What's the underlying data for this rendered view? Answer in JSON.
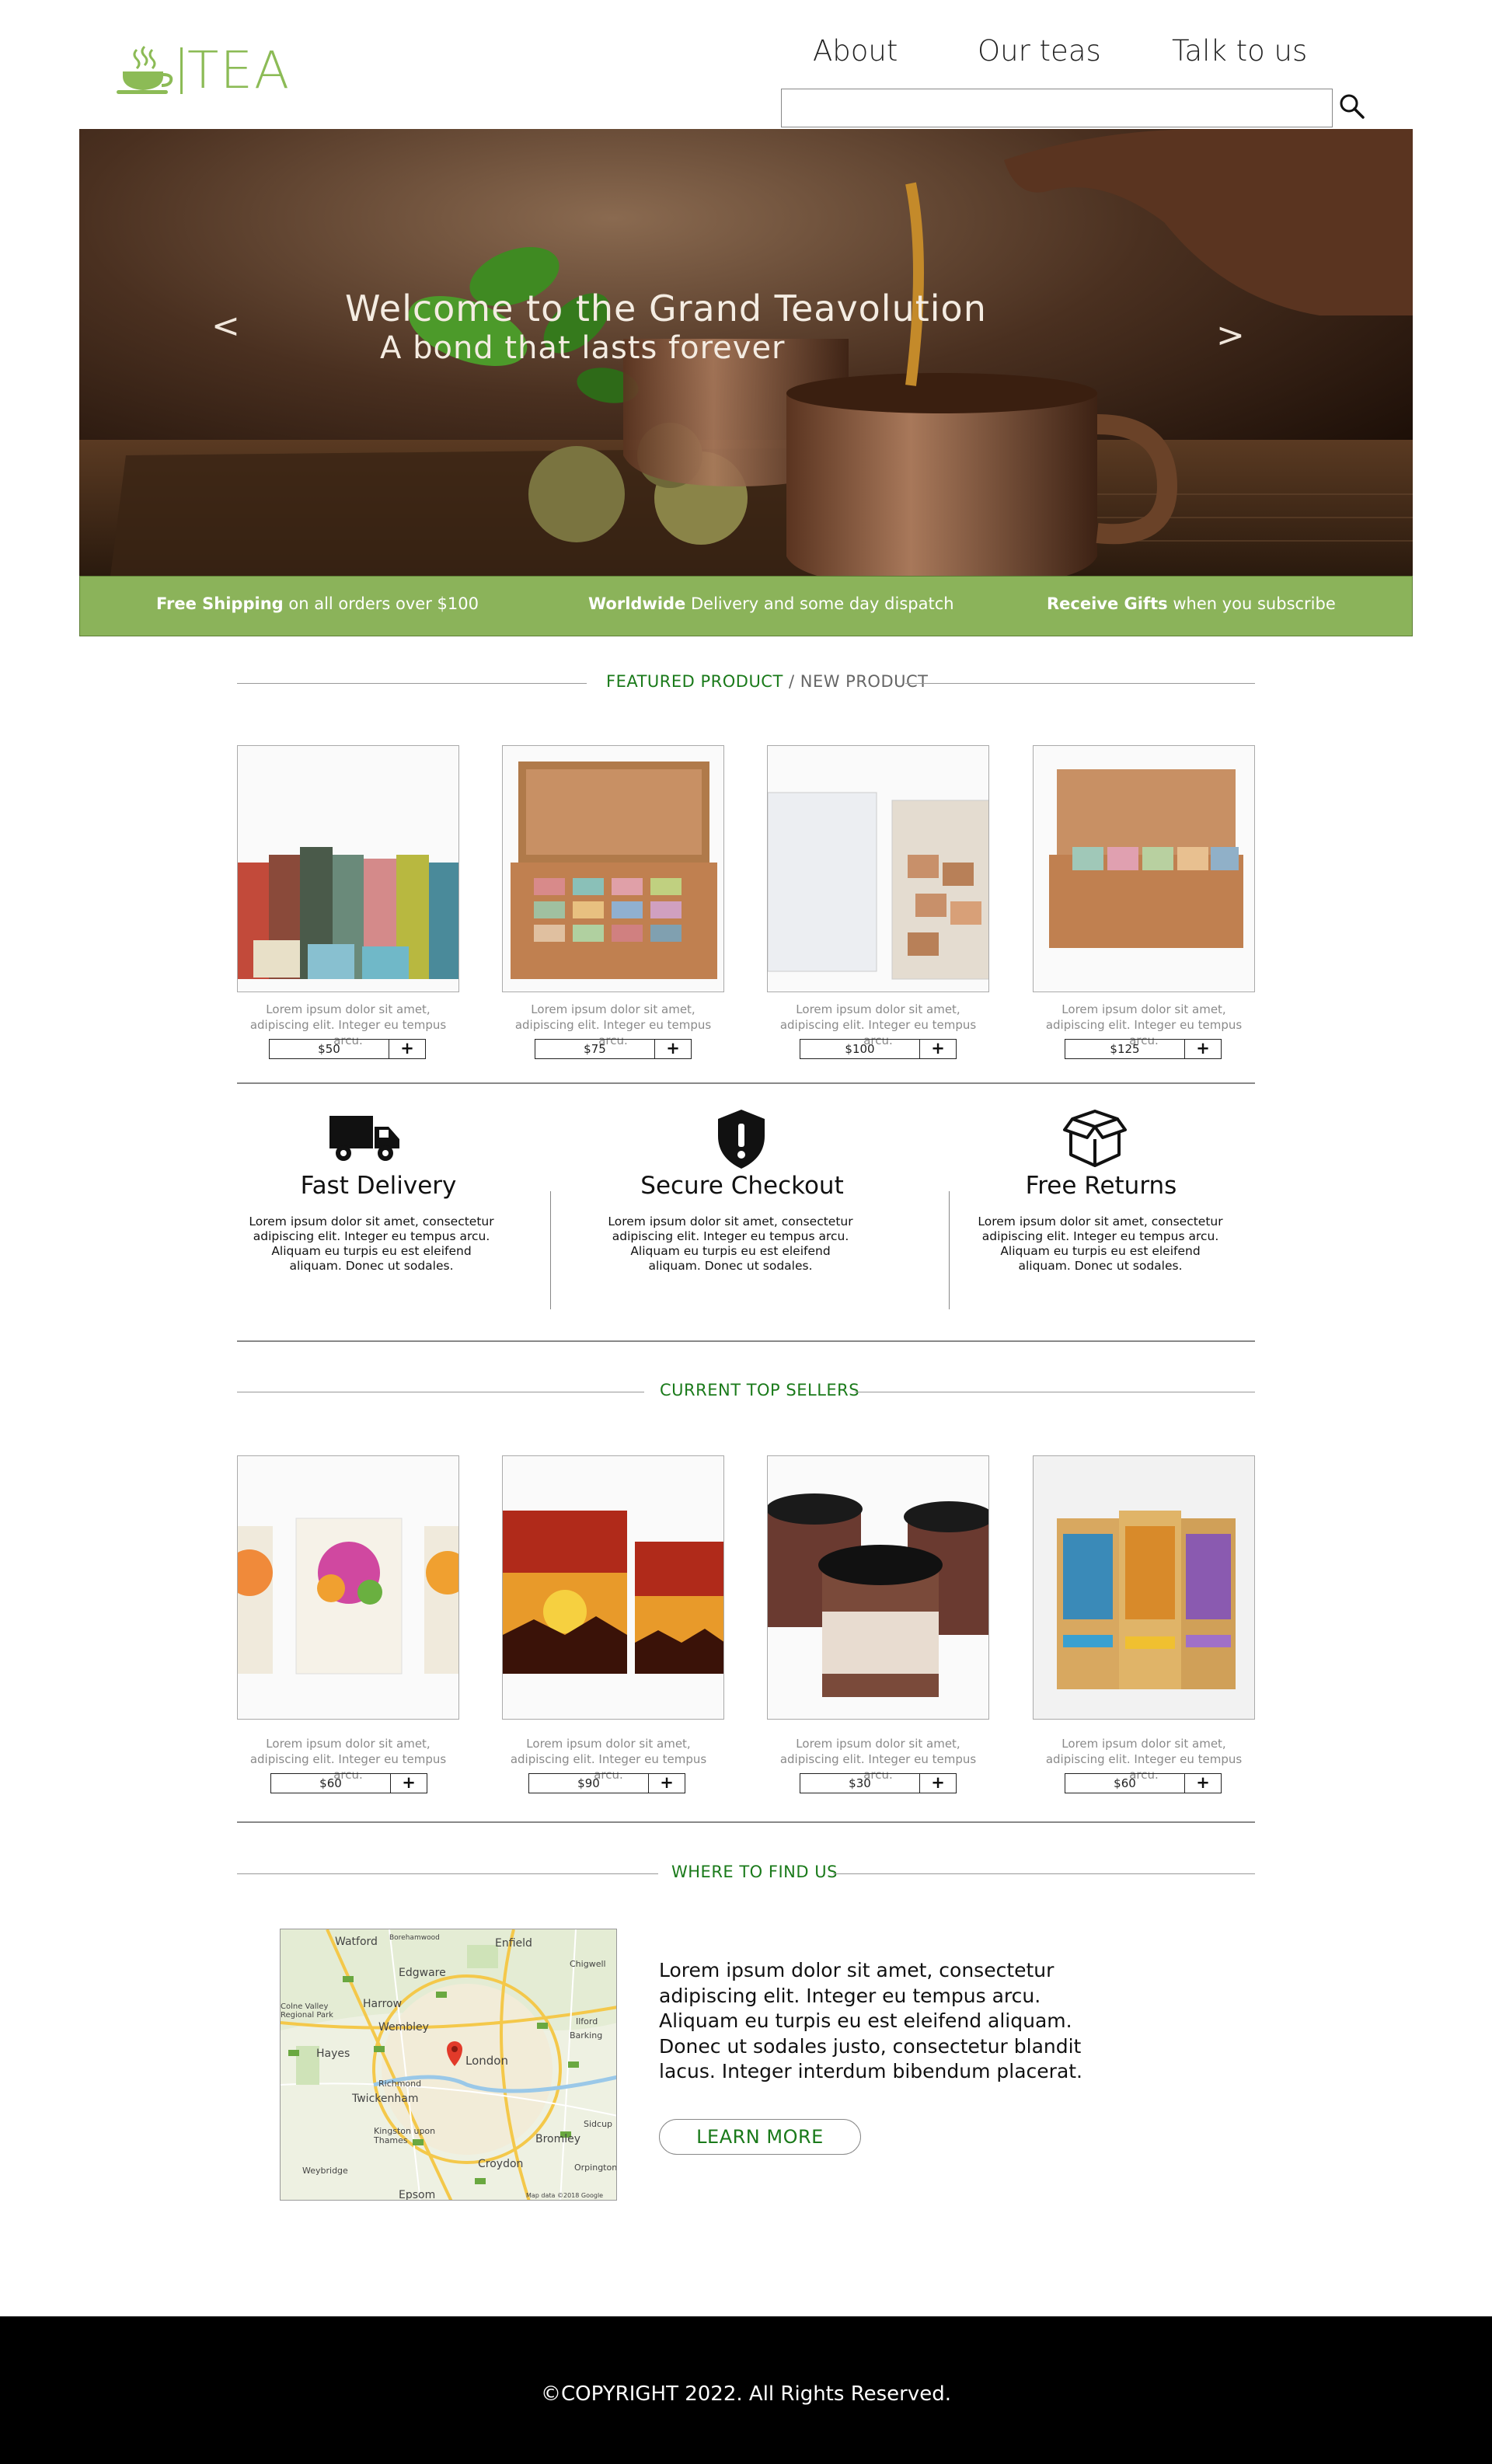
{
  "header": {
    "brand": "TEA",
    "nav": [
      "About",
      "Our teas",
      "Talk to us"
    ],
    "search_placeholder": ""
  },
  "hero": {
    "title": "Welcome to the Grand Teavolution",
    "subtitle": "A bond that lasts forever",
    "prev_icon": "<",
    "next_icon": ">"
  },
  "shipping": [
    {
      "bold": "Free Shipping",
      "text": " on all orders over $100"
    },
    {
      "bold": "Worldwide",
      "text": " Delivery and some day dispatch"
    },
    {
      "bold": "Receive Gifts",
      "text": " when you subscribe"
    }
  ],
  "featured": {
    "title_highlight": "FEATURED PRODUCT",
    "title_rest": " / NEW PRODUCT",
    "products": [
      {
        "desc": "Lorem ipsum dolor sit amet, adipiscing elit. Integer eu tempus arcu.",
        "price": "$50",
        "add": "+"
      },
      {
        "desc": "Lorem ipsum dolor sit amet, adipiscing elit. Integer eu tempus arcu.",
        "price": "$75",
        "add": "+"
      },
      {
        "desc": "Lorem ipsum dolor sit amet, adipiscing elit. Integer eu tempus arcu.",
        "price": "$100",
        "add": "+"
      },
      {
        "desc": "Lorem ipsum dolor sit amet, adipiscing elit. Integer eu tempus arcu.",
        "price": "$125",
        "add": "+"
      }
    ]
  },
  "features": [
    {
      "icon": "truck-icon",
      "title": "Fast Delivery",
      "text": "Lorem ipsum dolor sit amet, consectetur adipiscing elit. Integer eu tempus arcu. Aliquam eu turpis eu est eleifend aliquam. Donec ut sodales."
    },
    {
      "icon": "shield-icon",
      "title": "Secure Checkout",
      "text": "Lorem ipsum dolor sit amet, consectetur adipiscing elit. Integer eu tempus arcu. Aliquam eu turpis eu est eleifend aliquam. Donec ut sodales."
    },
    {
      "icon": "box-icon",
      "title": "Free Returns",
      "text": "Lorem ipsum dolor sit amet, consectetur adipiscing elit. Integer eu tempus arcu. Aliquam eu turpis eu est eleifend aliquam. Donec ut sodales."
    }
  ],
  "top_sellers": {
    "title": "CURRENT TOP SELLERS",
    "products": [
      {
        "desc": "Lorem ipsum dolor sit amet, adipiscing elit. Integer eu tempus arcu.",
        "price": "$60",
        "add": "+"
      },
      {
        "desc": "Lorem ipsum dolor sit amet, adipiscing elit. Integer eu tempus arcu.",
        "price": "$90",
        "add": "+"
      },
      {
        "desc": "Lorem ipsum dolor sit amet, adipiscing elit. Integer eu tempus arcu.",
        "price": "$30",
        "add": "+"
      },
      {
        "desc": "Lorem ipsum dolor sit amet, adipiscing elit. Integer eu tempus arcu.",
        "price": "$60",
        "add": "+"
      }
    ]
  },
  "find_us": {
    "title": "WHERE TO FIND US",
    "text": "Lorem ipsum dolor sit amet, consectetur adipiscing elit. Integer eu tempus arcu. Aliquam eu turpis eu est eleifend aliquam. Donec ut sodales justo, consectetur blandit lacus. Integer interdum bibendum placerat.",
    "button": "LEARN MORE",
    "map_labels": [
      "Watford",
      "Enfield",
      "Edgware",
      "Harrow",
      "Wembley",
      "Hayes",
      "London",
      "Twickenham",
      "Richmond",
      "Kingston upon Thames",
      "Croydon",
      "Bromley",
      "Epsom",
      "Ilford",
      "Barking",
      "Sidcup",
      "Orpington",
      "Weybridge",
      "Chigwell",
      "Colne Valley Regional Park",
      "Borehamwood",
      "Map data ©2018 Google"
    ]
  },
  "footer": {
    "copyright": "©COPYRIGHT 2022. All Rights Reserved."
  },
  "colors": {
    "accent": "#8bb35a",
    "green_text": "#1a7a1a",
    "footer": "#000000"
  }
}
